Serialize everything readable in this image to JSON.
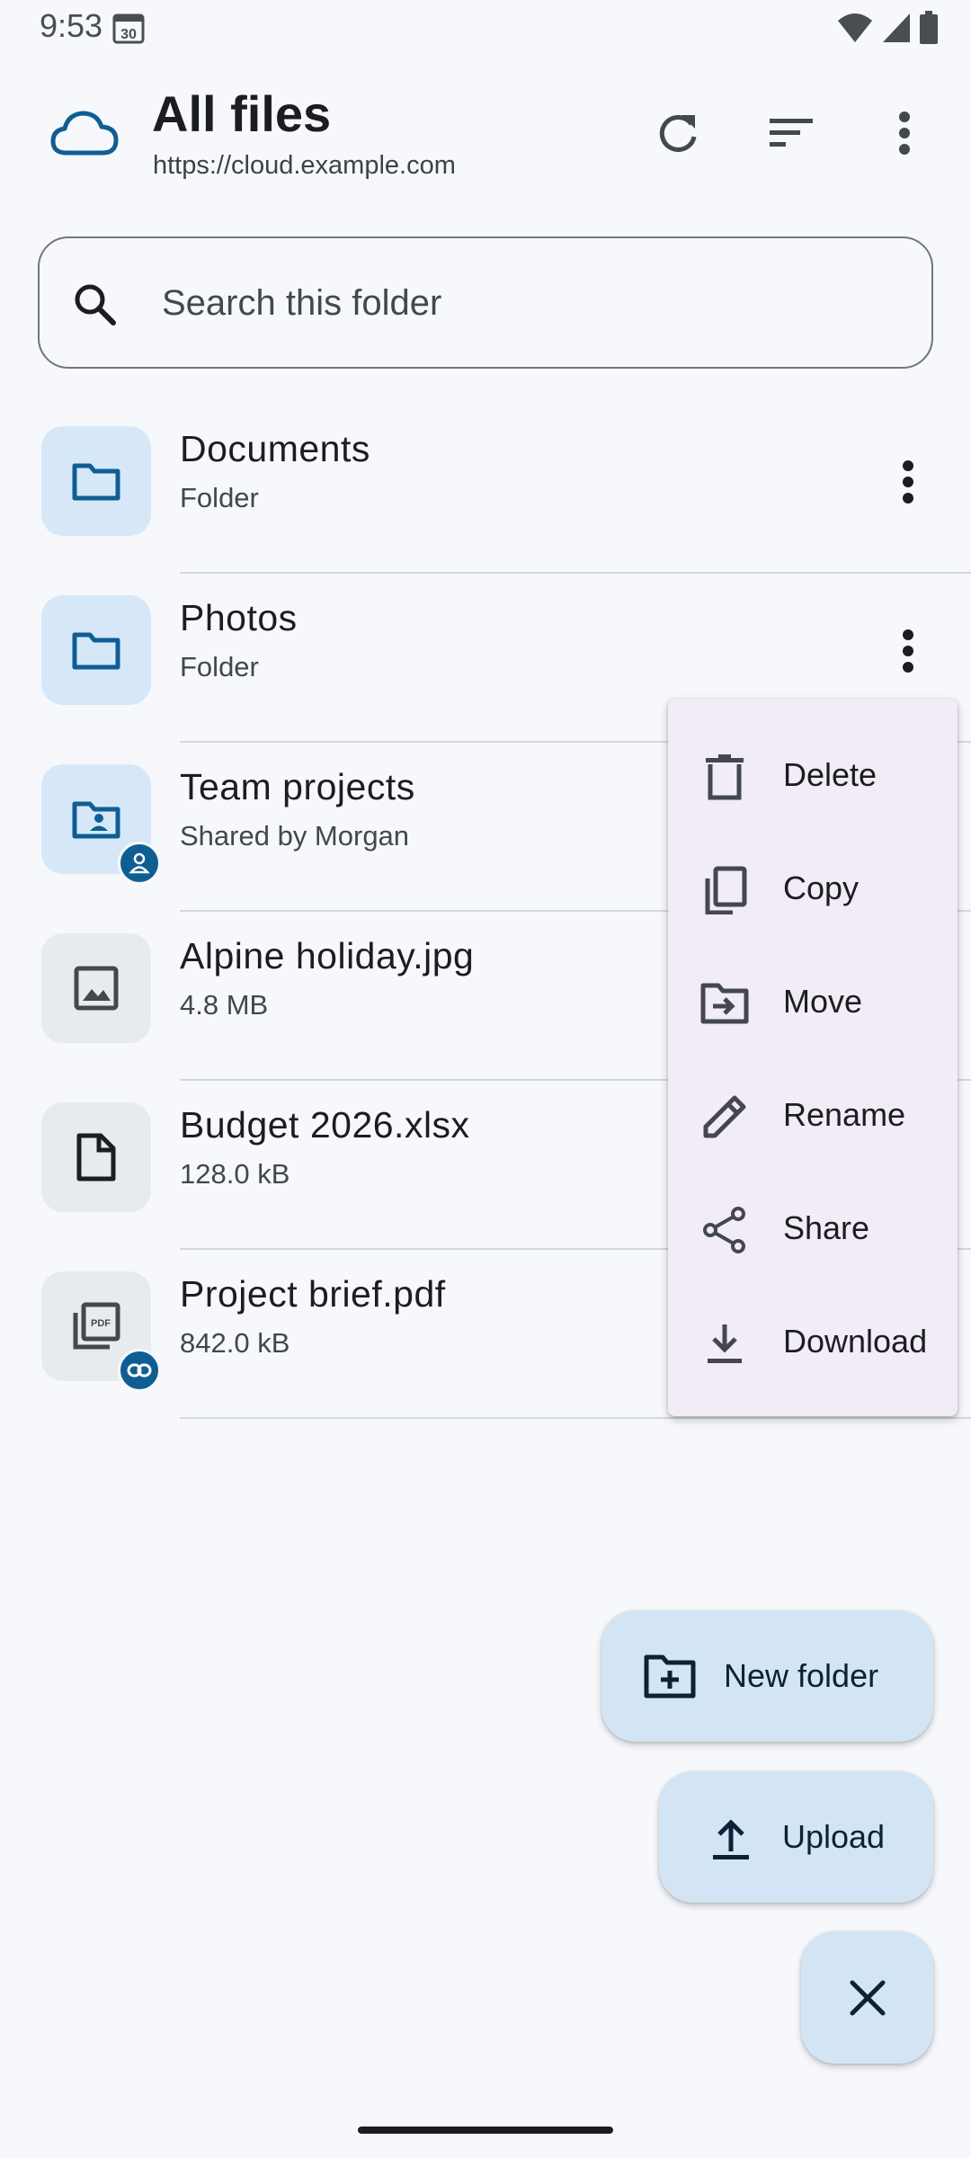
{
  "status_bar": {
    "time": "9:53",
    "calendar_day": "30"
  },
  "app_bar": {
    "title": "All files",
    "subtitle": "https://cloud.example.com"
  },
  "search": {
    "placeholder": "Search this folder",
    "value": ""
  },
  "files": [
    {
      "name": "Documents",
      "meta": "Folder"
    },
    {
      "name": "Photos",
      "meta": "Folder"
    },
    {
      "name": "Team projects",
      "meta": "Shared by Morgan"
    },
    {
      "name": "Alpine holiday.jpg",
      "meta": "4.8 MB"
    },
    {
      "name": "Budget 2026.xlsx",
      "meta": "128.0 kB"
    },
    {
      "name": "Project brief.pdf",
      "meta": "842.0 kB"
    }
  ],
  "context_menu": {
    "items": [
      {
        "label": "Delete",
        "icon": "delete-icon"
      },
      {
        "label": "Copy",
        "icon": "copy-icon"
      },
      {
        "label": "Move",
        "icon": "move-icon"
      },
      {
        "label": "Rename",
        "icon": "rename-icon"
      },
      {
        "label": "Share",
        "icon": "share-icon"
      },
      {
        "label": "Download",
        "icon": "download-icon"
      }
    ]
  },
  "fabs": {
    "new_folder": "New folder",
    "upload": "Upload"
  },
  "colors": {
    "accent": "#0f5e93",
    "folder_tile": "#d6e8f8",
    "file_tile": "#e8ebee",
    "menu_bg": "#f1ecf6",
    "fab_bg": "#d3e5f4"
  }
}
